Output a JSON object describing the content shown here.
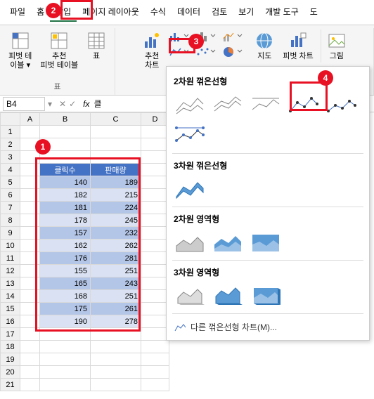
{
  "menu": {
    "items": [
      "파일",
      "홈",
      "삽입",
      "페이지 레이아웃",
      "수식",
      "데이터",
      "검토",
      "보기",
      "개발 도구",
      "도"
    ],
    "activeIndex": 2
  },
  "ribbon": {
    "pivot": {
      "pivotTable": "피벗 테\n이블 ▾",
      "recommended": "추천\n피벗 테이블",
      "groupLabel": "표"
    },
    "table": "표",
    "recommendedChart": "추천\n차트",
    "map": "지도",
    "pivotChart": "피벗 차트",
    "image": "그림"
  },
  "formula": {
    "nameBox": "B4",
    "fxValue": "클"
  },
  "grid": {
    "cols": [
      "A",
      "B",
      "C",
      "D"
    ],
    "rows": 21,
    "headers": {
      "b": "클릭수",
      "c": "판매량"
    },
    "data": [
      {
        "b": 140,
        "c": 189
      },
      {
        "b": 182,
        "c": 215
      },
      {
        "b": 181,
        "c": 224
      },
      {
        "b": 178,
        "c": 245
      },
      {
        "b": 157,
        "c": 232
      },
      {
        "b": 162,
        "c": 262
      },
      {
        "b": 176,
        "c": 281
      },
      {
        "b": 155,
        "c": 251
      },
      {
        "b": 165,
        "c": 243
      },
      {
        "b": 168,
        "c": 251
      },
      {
        "b": 175,
        "c": 261
      },
      {
        "b": 190,
        "c": 278
      }
    ]
  },
  "dropdown": {
    "s1": "2차원 꺾은선형",
    "s2": "3차원 꺾은선형",
    "s3": "2차원 영역형",
    "s4": "3차원 영역형",
    "footer": "다른 꺾은선형 차트(M)..."
  },
  "callouts": {
    "c1": "1",
    "c2": "2",
    "c3": "3",
    "c4": "4"
  }
}
